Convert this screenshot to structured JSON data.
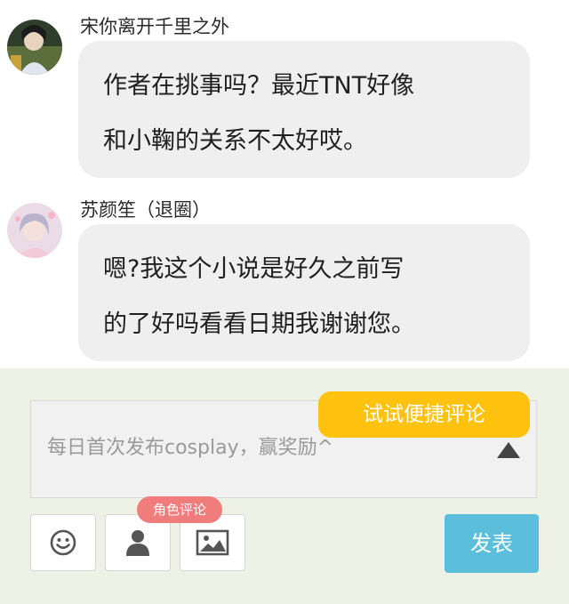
{
  "comments": [
    {
      "username": "宋你离开千里之外",
      "lines": [
        "作者在挑事吗？最近TNT好像",
        "和小鞠的关系不太好哎。"
      ]
    },
    {
      "username": "苏颜笙（退圈）",
      "lines": [
        "嗯?我这个小说是好久之前写",
        "的了好吗看看日期我谢谢您。"
      ]
    }
  ],
  "composer": {
    "placeholder": "每日首次发布cosplay，赢奖励^",
    "quick_comment_tip": "试试便捷评论",
    "role_badge": "角色评论",
    "send_label": "发表",
    "accent_tip": "#ffc20e",
    "accent_send": "#5bbfdb",
    "accent_badge": "#f07c7c"
  },
  "icons": {
    "emoji": "smiley-icon",
    "role": "person-icon",
    "image": "image-icon",
    "expand": "triangle-up-icon"
  }
}
